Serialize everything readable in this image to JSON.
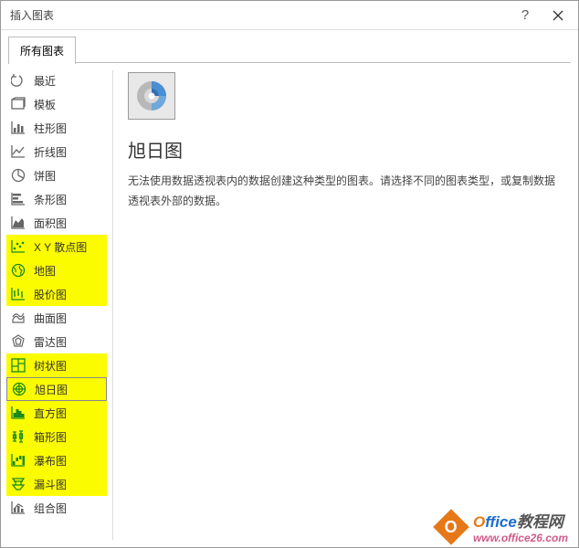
{
  "dialog": {
    "title": "插入图表",
    "help": "?",
    "tab": "所有图表"
  },
  "sidebar": {
    "items": [
      {
        "label": "最近",
        "icon": "recent-icon",
        "hl": false,
        "selected": false
      },
      {
        "label": "模板",
        "icon": "template-icon",
        "hl": false,
        "selected": false
      },
      {
        "label": "柱形图",
        "icon": "column-chart-icon",
        "hl": false,
        "selected": false
      },
      {
        "label": "折线图",
        "icon": "line-chart-icon",
        "hl": false,
        "selected": false
      },
      {
        "label": "饼图",
        "icon": "pie-chart-icon",
        "hl": false,
        "selected": false
      },
      {
        "label": "条形图",
        "icon": "bar-chart-icon",
        "hl": false,
        "selected": false
      },
      {
        "label": "面积图",
        "icon": "area-chart-icon",
        "hl": false,
        "selected": false
      },
      {
        "label": "X Y 散点图",
        "icon": "scatter-chart-icon",
        "hl": true,
        "selected": false
      },
      {
        "label": "地图",
        "icon": "map-chart-icon",
        "hl": true,
        "selected": false
      },
      {
        "label": "股价图",
        "icon": "stock-chart-icon",
        "hl": true,
        "selected": false
      },
      {
        "label": "曲面图",
        "icon": "surface-chart-icon",
        "hl": false,
        "selected": false
      },
      {
        "label": "雷达图",
        "icon": "radar-chart-icon",
        "hl": false,
        "selected": false
      },
      {
        "label": "树状图",
        "icon": "treemap-chart-icon",
        "hl": true,
        "selected": false
      },
      {
        "label": "旭日图",
        "icon": "sunburst-chart-icon",
        "hl": true,
        "selected": true
      },
      {
        "label": "直方图",
        "icon": "histogram-chart-icon",
        "hl": true,
        "selected": false
      },
      {
        "label": "箱形图",
        "icon": "box-chart-icon",
        "hl": true,
        "selected": false
      },
      {
        "label": "瀑布图",
        "icon": "waterfall-chart-icon",
        "hl": true,
        "selected": false
      },
      {
        "label": "漏斗图",
        "icon": "funnel-chart-icon",
        "hl": true,
        "selected": false
      },
      {
        "label": "组合图",
        "icon": "combo-chart-icon",
        "hl": false,
        "selected": false
      }
    ]
  },
  "main": {
    "title": "旭日图",
    "description": "无法使用数据透视表内的数据创建这种类型的图表。请选择不同的图表类型，或复制数据透视表外部的数据。"
  },
  "watermark": {
    "brand_o": "O",
    "brand_rest": "ffice",
    "brand_cn": "教程网",
    "url": "www.office26.com",
    "logo_letter": "O"
  }
}
